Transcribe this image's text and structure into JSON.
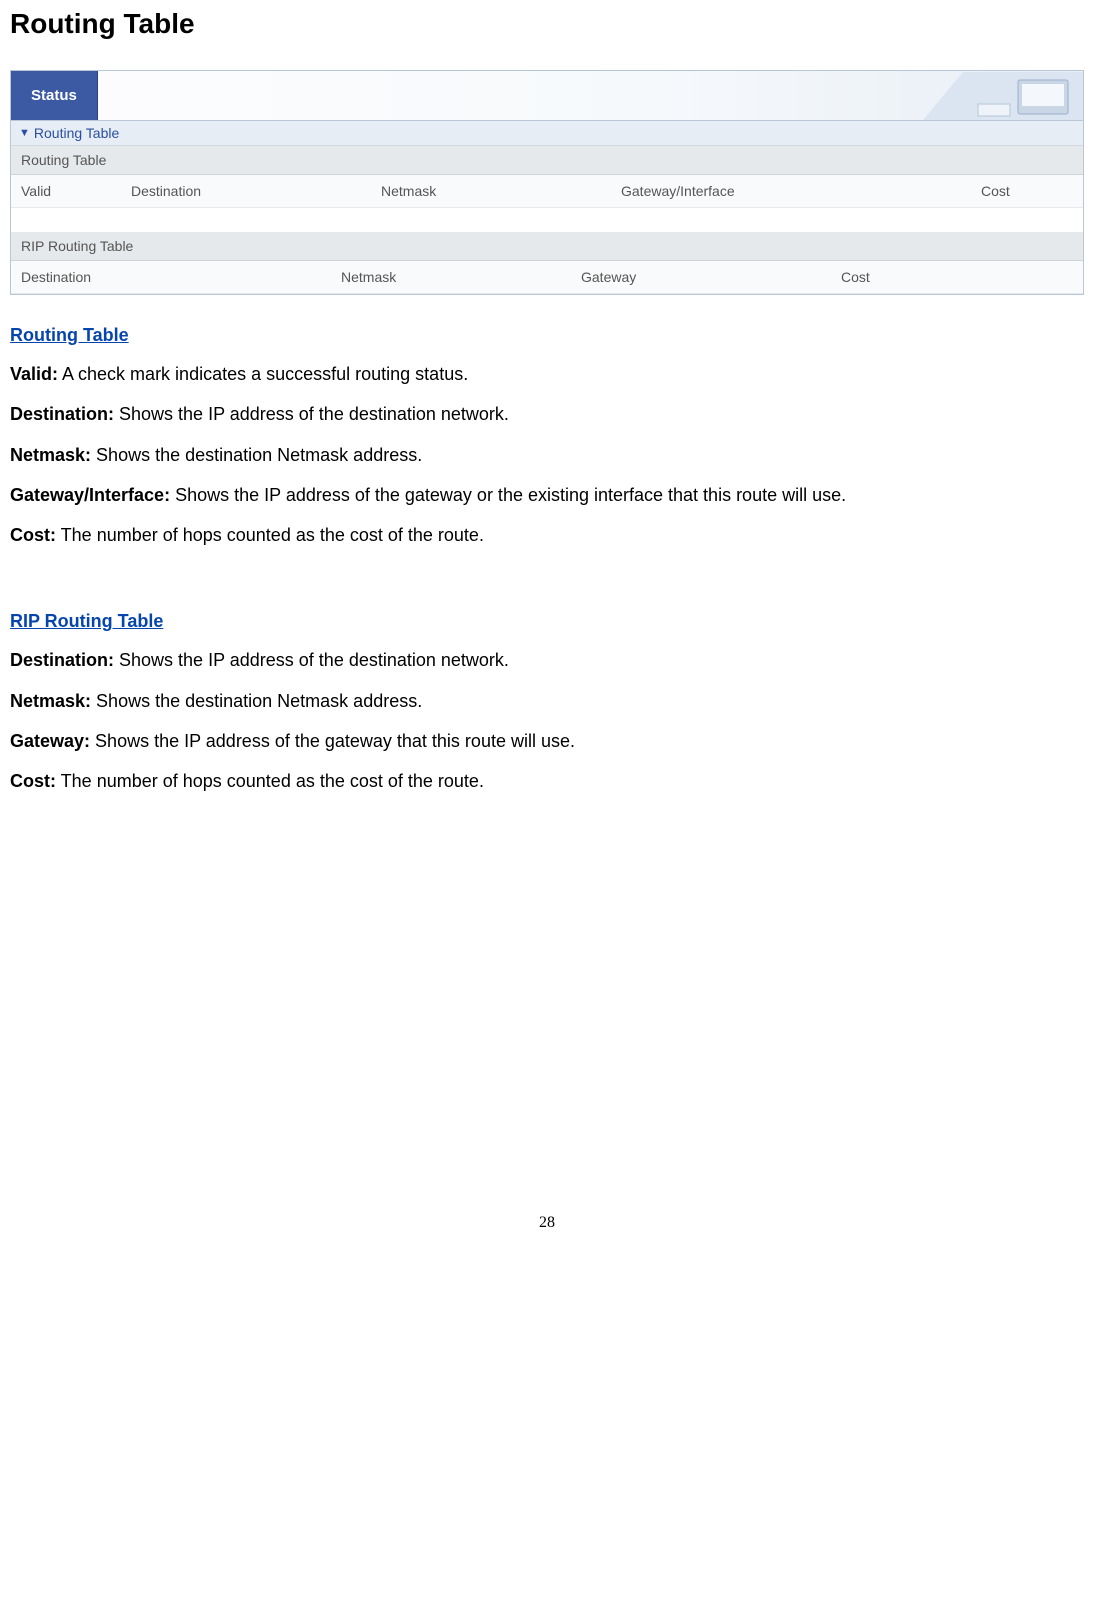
{
  "page_title": "Routing Table",
  "panel": {
    "status_tab": "Status",
    "routing_section": {
      "header": "Routing Table",
      "subheader": "Routing Table",
      "columns": {
        "valid": "Valid",
        "destination": "Destination",
        "netmask": "Netmask",
        "gateway_interface": "Gateway/Interface",
        "cost": "Cost"
      }
    },
    "rip_section": {
      "subheader": "RIP Routing Table",
      "columns": {
        "destination": "Destination",
        "netmask": "Netmask",
        "gateway": "Gateway",
        "cost": "Cost"
      }
    }
  },
  "doc": {
    "section1_title": "Routing Table",
    "defs1": [
      {
        "term": "Valid:",
        "desc": "  A check mark indicates a successful routing status."
      },
      {
        "term": "Destination:",
        "desc": " Shows the IP address of the destination network."
      },
      {
        "term": "Netmask:",
        "desc": " Shows the destination Netmask address."
      },
      {
        "term": "Gateway/Interface:",
        "desc": " Shows the IP address of the gateway or the existing interface that this route will use."
      },
      {
        "term": "Cost:",
        "desc": " The number of hops counted as the cost of the route."
      }
    ],
    "section2_title": "RIP Routing Table",
    "defs2": [
      {
        "term": "Destination:",
        "desc": " Shows the IP address of the destination network."
      },
      {
        "term": "Netmask:",
        "desc": " Shows the destination Netmask address."
      },
      {
        "term": "Gateway:",
        "desc": " Shows the IP address of the gateway that this route will use."
      },
      {
        "term": "Cost:",
        "desc": " The number of hops counted as the cost of the route."
      }
    ]
  },
  "page_number": "28"
}
